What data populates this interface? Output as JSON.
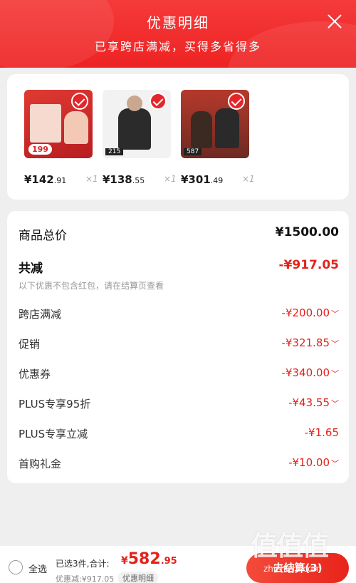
{
  "header": {
    "title": "优惠明细",
    "subtitle": "已享跨店满减，买得多省得多"
  },
  "products": [
    {
      "price_int": "¥142",
      "price_dec": ".91",
      "qty": "×1",
      "thumb_text": "199",
      "thumb_color": "#d8262a"
    },
    {
      "price_int": "¥138",
      "price_dec": ".55",
      "qty": "×1",
      "thumb_text": "215",
      "thumb_color": "#ececec"
    },
    {
      "price_int": "¥301",
      "price_dec": ".49",
      "qty": "×1",
      "thumb_text": "587",
      "thumb_color": "#a0312a"
    }
  ],
  "summary": {
    "total_label": "商品总价",
    "total_value": "¥1500.00",
    "reduce_label": "共减",
    "reduce_value": "-¥917.05",
    "note": "以下优惠不包含红包，请在结算页查看",
    "items": [
      {
        "label": "跨店满减",
        "value": "-¥200.00",
        "chevron": "﹀"
      },
      {
        "label": "促销",
        "value": "-¥321.85",
        "chevron": "﹀"
      },
      {
        "label": "优惠券",
        "value": "-¥340.00",
        "chevron": "﹀"
      },
      {
        "label": "PLUS专享95折",
        "value": "-¥43.55",
        "chevron": "﹀"
      },
      {
        "label": "PLUS专享立减",
        "value": "-¥1.65",
        "chevron": ""
      },
      {
        "label": "首购礼金",
        "value": "-¥10.00",
        "chevron": "﹀"
      }
    ]
  },
  "footer": {
    "select_all": "全选",
    "selected_info": "已选3件,合计:",
    "total_symbol": "¥",
    "total_int": "582",
    "total_dec": ".95",
    "discount_line": "优惠减:¥917.05",
    "detail_tag": "优惠明细",
    "checkout": "去结算(3)"
  },
  "watermark": {
    "logo": "值值值",
    "text": "zhizhizhi.com"
  },
  "colors": {
    "accent": "#e2231a",
    "header": "#f03030"
  }
}
